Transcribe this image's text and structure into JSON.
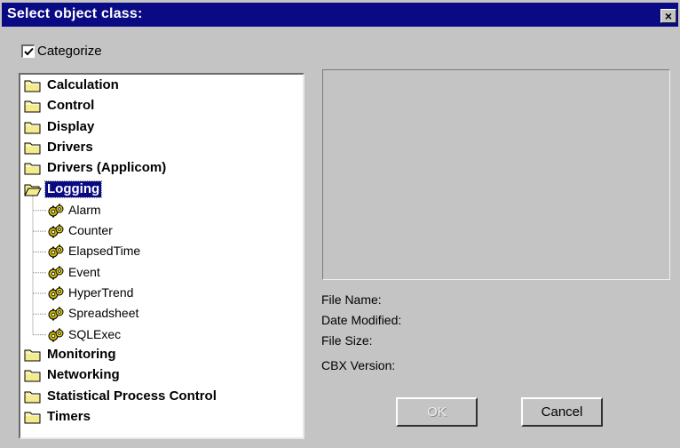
{
  "dialog": {
    "title": "Select object class:",
    "close_label": "×"
  },
  "categorize": {
    "label": "Categorize",
    "checked": true
  },
  "tree": {
    "categories_before": [
      {
        "label": "Calculation",
        "icon": "folder-closed-icon"
      },
      {
        "label": "Control",
        "icon": "folder-closed-icon"
      },
      {
        "label": "Display",
        "icon": "folder-closed-icon"
      },
      {
        "label": "Drivers",
        "icon": "folder-closed-icon"
      },
      {
        "label": "Drivers (Applicom)",
        "icon": "folder-closed-icon"
      }
    ],
    "expanded": {
      "label": "Logging",
      "icon": "folder-open-icon",
      "selected": true,
      "children": [
        {
          "label": "Alarm",
          "icon": "gear-icon"
        },
        {
          "label": "Counter",
          "icon": "gear-icon"
        },
        {
          "label": "ElapsedTime",
          "icon": "gear-icon"
        },
        {
          "label": "Event",
          "icon": "gear-icon"
        },
        {
          "label": "HyperTrend",
          "icon": "gear-icon"
        },
        {
          "label": "Spreadsheet",
          "icon": "gear-icon"
        },
        {
          "label": "SQLExec",
          "icon": "gear-icon"
        }
      ]
    },
    "categories_after": [
      {
        "label": "Monitoring",
        "icon": "folder-closed-icon"
      },
      {
        "label": "Networking",
        "icon": "folder-closed-icon"
      },
      {
        "label": "Statistical Process Control",
        "icon": "folder-closed-icon"
      },
      {
        "label": "Timers",
        "icon": "folder-closed-icon"
      }
    ]
  },
  "info": {
    "file_name": "File Name:",
    "date_modified": "Date Modified:",
    "file_size": "File Size:",
    "cbx_version": "CBX Version:"
  },
  "buttons": {
    "ok": "OK",
    "cancel": "Cancel"
  },
  "colors": {
    "titlebar": "#0a0a84",
    "face": "#c4c4c4",
    "folder": "#f4ec8c"
  }
}
